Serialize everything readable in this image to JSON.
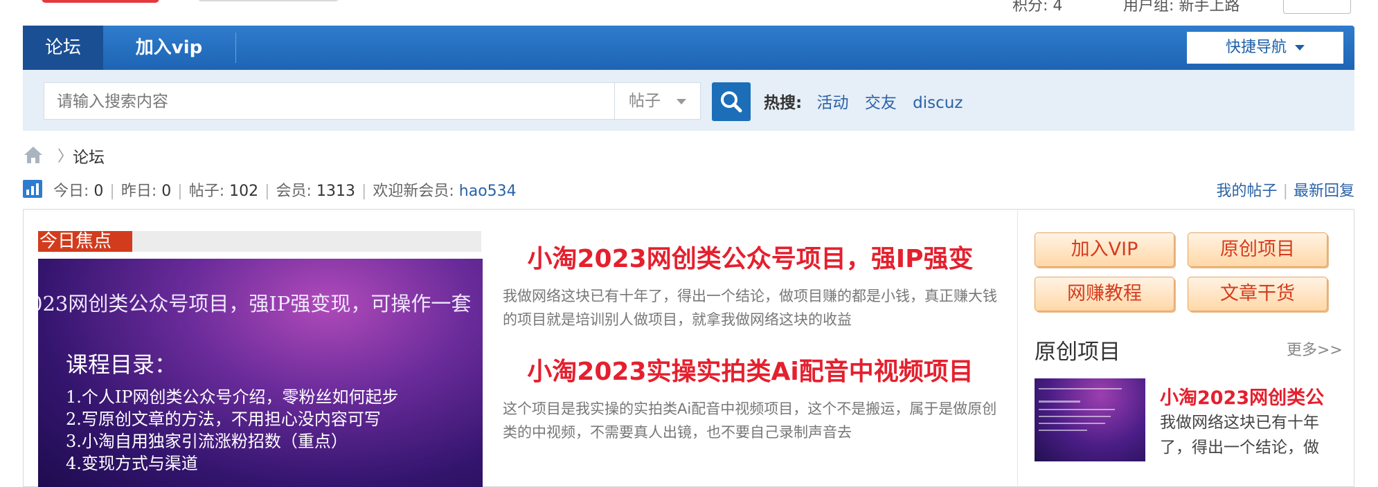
{
  "top": {
    "points_text": "积分: 4",
    "usergroup_text": "用户组: 新手上路"
  },
  "nav": {
    "tabs": [
      {
        "label": "论坛"
      },
      {
        "label": "加入vip"
      }
    ],
    "quick_nav": "快捷导航"
  },
  "search": {
    "placeholder": "请输入搜索内容",
    "type_selected": "帖子",
    "hot_label": "热搜:",
    "hot_items": [
      "活动",
      "交友",
      "discuz"
    ]
  },
  "breadcrumb": {
    "separator": "〉",
    "current": "论坛"
  },
  "stats": {
    "today_label": "今日:",
    "today_value": "0",
    "yesterday_label": "昨日:",
    "yesterday_value": "0",
    "posts_label": "帖子:",
    "posts_value": "102",
    "members_label": "会员:",
    "members_value": "1313",
    "welcome_label": "欢迎新会员:",
    "welcome_user": "hao534",
    "my_posts": "我的帖子",
    "latest_replies": "最新回复"
  },
  "focus": {
    "tag": "今日焦点",
    "image_lines": [
      "023网创类公众号项目，强IP强变现，可操作一套",
      "课程目录：",
      "1.个人IP网创类公众号介绍，零粉丝如何起步",
      "2.写原创文章的方法，不用担心没内容可写",
      "3.小淘自用独家引流涨粉招数（重点）",
      "4.变现方式与渠道"
    ],
    "posts": [
      {
        "title": "小淘2023网创类公众号项目，强IP强变",
        "excerpt": "我做网络这块已有十年了，得出一个结论，做项目赚的都是小钱，真正赚大钱的项目就是培训别人做项目，就拿我做网络这块的收益"
      },
      {
        "title": "小淘2023实操实拍类Ai配音中视频项目",
        "excerpt": "这个项目是我实操的实拍类Ai配音中视频项目，这个不是搬运，属于是做原创类的中视频，不需要真人出镜，也不要自己录制声音去"
      }
    ]
  },
  "quick_links": [
    "加入VIP",
    "原创项目",
    "网赚教程",
    "文章干货"
  ],
  "section": {
    "title": "原创项目",
    "more": "更多>>",
    "item_title": "小淘2023网创类公",
    "item_excerpt": "我做网络这块已有十年了，得出一个结论，做"
  },
  "colors": {
    "nav_blue": "#1e64b4",
    "accent_red": "#e4202e",
    "link_blue": "#2a62a8"
  }
}
